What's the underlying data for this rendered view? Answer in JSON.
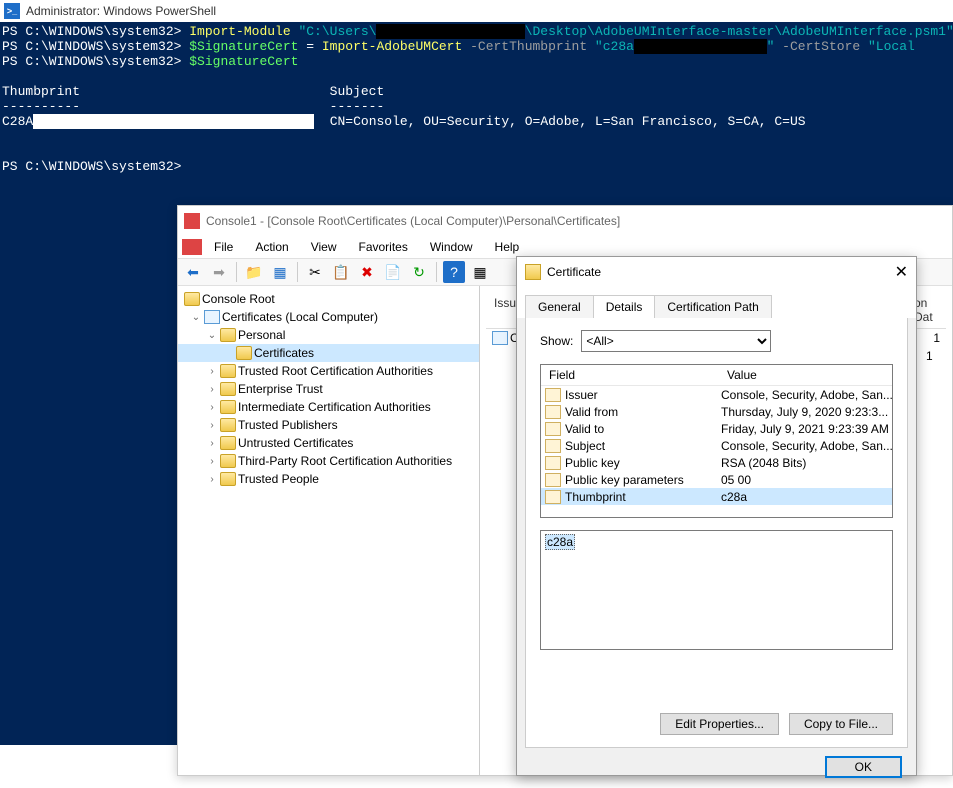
{
  "powershell": {
    "title": "Administrator: Windows PowerShell",
    "lines": {
      "p1_prompt": "PS C:\\WINDOWS\\system32> ",
      "p1_cmd": "Import-Module ",
      "p1_str_a": "\"C:\\Users\\",
      "p1_str_b": "\\Desktop\\AdobeUMInterface-master\\AdobeUMInterface.psm1\"",
      "p2_prompt": "PS C:\\WINDOWS\\system32> ",
      "p2_var": "$SignatureCert",
      "p2_eq": " = ",
      "p2_cmd": "Import-AdobeUMCert",
      "p2_param1": " -CertThumbprint ",
      "p2_str_a": "\"c28a",
      "p2_str_b": "\"",
      "p2_param2": " -CertStore ",
      "p2_str2": "\"Local",
      "p3_prompt": "PS C:\\WINDOWS\\system32> ",
      "p3_var": "$SignatureCert",
      "headers_thumb": "Thumbprint",
      "headers_subj": "Subject",
      "dashes1": "----------",
      "dashes2": "-------",
      "row_thumb": "C28A",
      "row_subj": "CN=Console, OU=Security, O=Adobe, L=San Francisco, S=CA, C=US",
      "p4_prompt": "PS C:\\WINDOWS\\system32>"
    }
  },
  "mmc": {
    "title": "Console1 - [Console Root\\Certificates (Local Computer)\\Personal\\Certificates]",
    "menu": [
      "File",
      "Action",
      "View",
      "Favorites",
      "Window",
      "Help"
    ],
    "tree": {
      "root": "Console Root",
      "certs": "Certificates (Local Computer)",
      "personal": "Personal",
      "certificates": "Certificates",
      "items": [
        "Trusted Root Certification Authorities",
        "Enterprise Trust",
        "Intermediate Certification Authorities",
        "Trusted Publishers",
        "Untrusted Certificates",
        "Third-Party Root Certification Authorities",
        "Trusted People"
      ]
    },
    "list": {
      "col1": "Issued",
      "col2": "on Dat",
      "row1": "Co",
      "val1": "1",
      "val2": "1"
    }
  },
  "cert": {
    "title": "Certificate",
    "tabs": [
      "General",
      "Details",
      "Certification Path"
    ],
    "active_tab": "Details",
    "show_label": "Show:",
    "show_value": "<All>",
    "field_header": "Field",
    "value_header": "Value",
    "fields": [
      {
        "name": "Issuer",
        "value": "Console, Security, Adobe, San..."
      },
      {
        "name": "Valid from",
        "value": "Thursday, July 9, 2020 9:23:3..."
      },
      {
        "name": "Valid to",
        "value": "Friday, July 9, 2021 9:23:39 AM"
      },
      {
        "name": "Subject",
        "value": "Console, Security, Adobe, San..."
      },
      {
        "name": "Public key",
        "value": "RSA (2048 Bits)"
      },
      {
        "name": "Public key parameters",
        "value": "05 00"
      },
      {
        "name": "Thumbprint",
        "value": "c28a"
      }
    ],
    "selected_field_index": 6,
    "value_box": "c28a",
    "btn_edit": "Edit Properties...",
    "btn_copy": "Copy to File...",
    "btn_ok": "OK"
  }
}
